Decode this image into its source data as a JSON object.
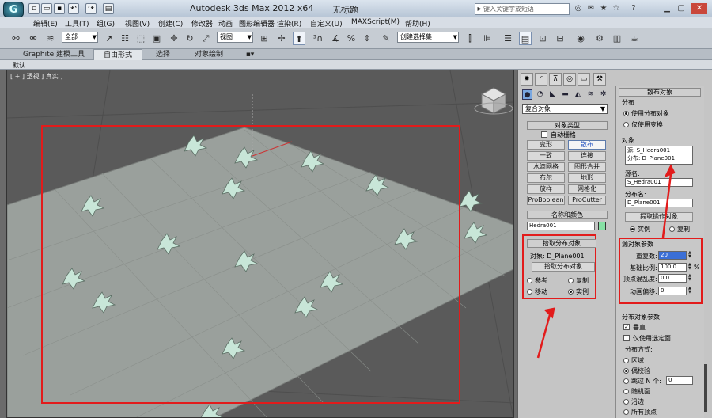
{
  "window": {
    "app_title": "Autodesk 3ds Max  2012 x64",
    "file_title": "无标题",
    "search_placeholder": "键入关键字或短语"
  },
  "menu": [
    "编辑(E)",
    "工具(T)",
    "组(G)",
    "视图(V)",
    "创建(C)",
    "修改器",
    "动画",
    "图形编辑器",
    "渲染(R)",
    "自定义(U)",
    "MAXScript(M)",
    "帮助(H)"
  ],
  "toolbar": {
    "select_filter": "全部",
    "ref_coord": "视图",
    "selection_set": "创建选择集"
  },
  "ribbon": {
    "tabs": [
      "Graphite 建模工具",
      "自由形式",
      "选择",
      "对象绘制"
    ],
    "active_tab": 1,
    "sub_label": "默认"
  },
  "viewport": {
    "label": "[ + ] 透视 ] 真实 ]"
  },
  "command_panel": {
    "category": "复合对象",
    "object_type": {
      "header": "对象类型",
      "autogrid": "自动栅格",
      "buttons": [
        [
          "变形",
          "散布"
        ],
        [
          "一致",
          "连接"
        ],
        [
          "水滴网格",
          "图形合并"
        ],
        [
          "布尔",
          "地形"
        ],
        [
          "放样",
          "网格化"
        ],
        [
          "ProBoolean",
          "ProCutter"
        ]
      ],
      "selected": "散布"
    },
    "name_color": {
      "header": "名称和颜色",
      "name": "Hedra001",
      "swatch": "#86e0a4"
    },
    "pick_distribution": {
      "header": "拾取分布对象",
      "object_label": "对象: D_Plane001",
      "pick_button": "拾取分布对象",
      "options": [
        "参考",
        "复制",
        "移动",
        "实例"
      ],
      "selected": "实例"
    },
    "scatter": {
      "header": "散布对象",
      "distribution_group": "分布",
      "use_dist": "使用分布对象",
      "use_transform": "仅使用变换",
      "object_group": "对象",
      "list": [
        "源: S_Hedra001",
        "分布: D_Plane001"
      ],
      "source_name_label": "源名:",
      "source_name": "S_Hedra001",
      "dist_name_label": "分布名:",
      "dist_name": "D_Plane001",
      "extract_button": "提取操作对象",
      "extract_options": [
        "实例",
        "复制"
      ],
      "extract_selected": "实例"
    },
    "source_params": {
      "header": "源对象参数",
      "rows": [
        {
          "label": "重复数:",
          "value": "20",
          "unit": ""
        },
        {
          "label": "基础比例:",
          "value": "100.0",
          "unit": "%"
        },
        {
          "label": "顶点混乱度:",
          "value": "0.0",
          "unit": ""
        },
        {
          "label": "动画偏移:",
          "value": "0",
          "unit": ""
        }
      ]
    },
    "dist_params": {
      "header": "分布对象参数",
      "perpendicular": "垂直",
      "use_selected_faces": "仅使用选定面",
      "method_label": "分布方式:",
      "methods": [
        "区域",
        "偶校验",
        "跳过 N 个:",
        "随机面",
        "沿边",
        "所有顶点"
      ],
      "selected": "偶校验",
      "skip_value": "0"
    }
  },
  "annotation_colors": {
    "highlight": "#e21b1b"
  }
}
